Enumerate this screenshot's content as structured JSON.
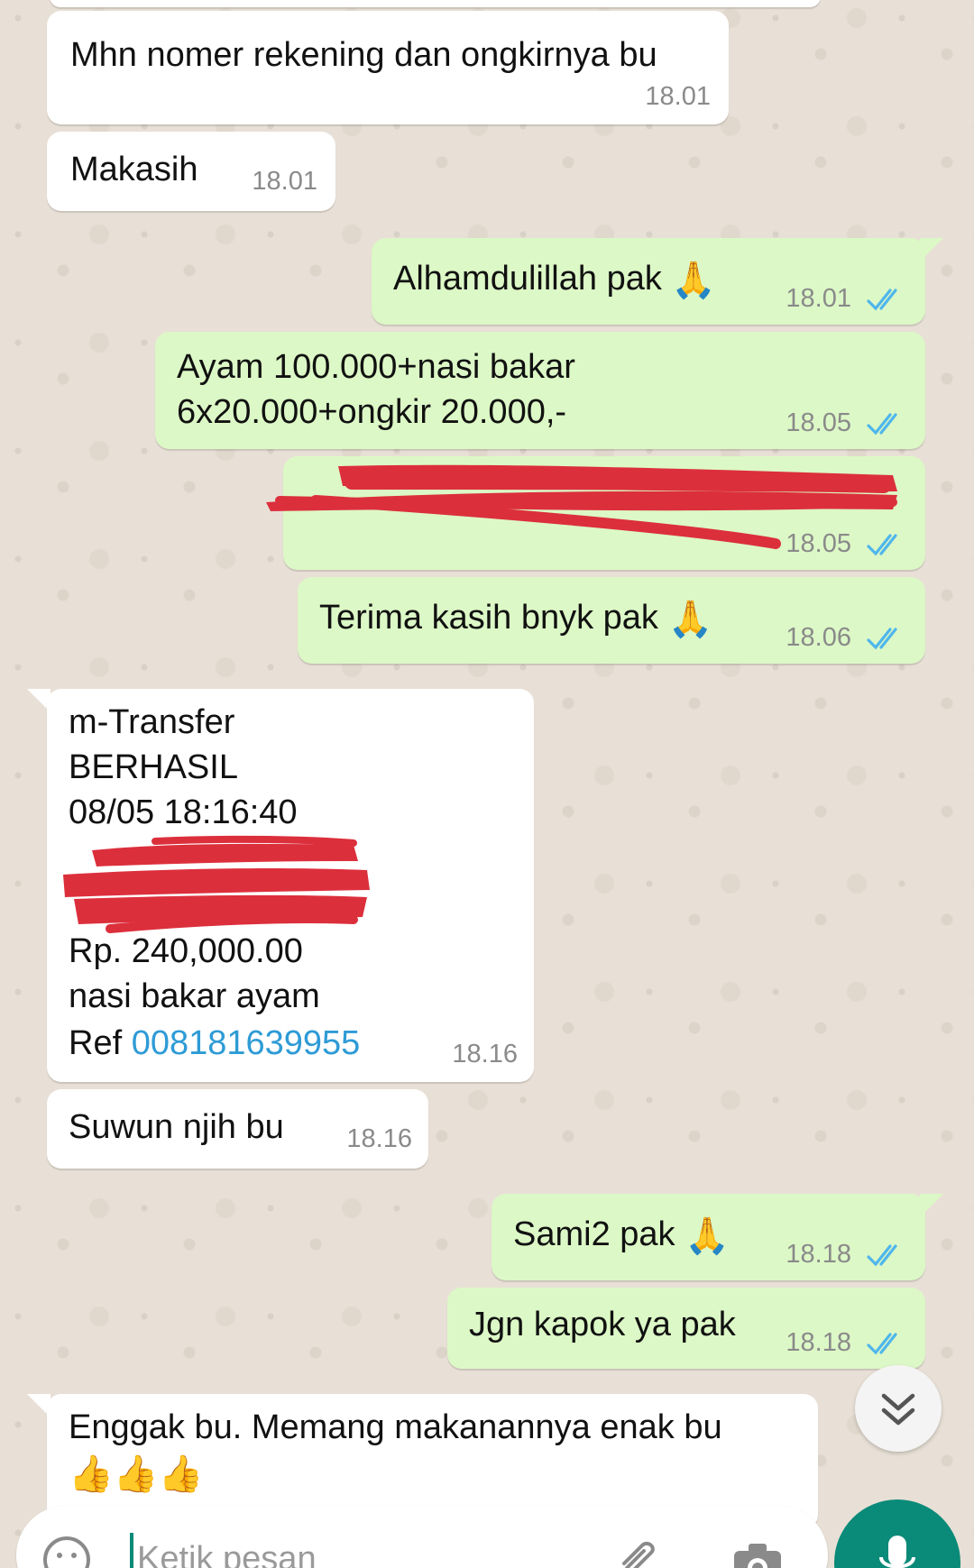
{
  "messages": [
    {
      "dir": "in",
      "text": "Mhn nomer rekening dan ongkirnya bu",
      "time": "18.01"
    },
    {
      "dir": "in",
      "text": "Makasih",
      "time": "18.01"
    },
    {
      "dir": "out",
      "text": "Alhamdulillah pak",
      "emoji": "🙏",
      "time": "18.01",
      "status": "read"
    },
    {
      "dir": "out",
      "lines": [
        "Ayam 100.000+nasi bakar",
        "6x20.000+ongkir 20.000,-"
      ],
      "time": "18.05",
      "status": "read"
    },
    {
      "dir": "out",
      "redacted": true,
      "time": "18.05",
      "status": "read"
    },
    {
      "dir": "out",
      "text": "Terima kasih bnyk pak",
      "emoji": "🙏",
      "time": "18.06",
      "status": "read"
    },
    {
      "dir": "in",
      "lines": [
        "m-Transfer",
        "BERHASIL",
        "08/05 18:16:40",
        "Rp. 240,000.00",
        "nasi bakar ayam"
      ],
      "ref_label": "Ref",
      "ref_number": "008181639955",
      "time": "18.16"
    },
    {
      "dir": "in",
      "text": "Suwun njih bu",
      "time": "18.16"
    },
    {
      "dir": "out",
      "text": "Sami2 pak",
      "emoji": "🙏",
      "time": "18.18",
      "status": "read"
    },
    {
      "dir": "out",
      "text": "Jgn kapok ya pak",
      "time": "18.18",
      "status": "read"
    },
    {
      "dir": "in",
      "text": "Enggak bu. Memang makanannya enak bu",
      "emoji": "👍👍👍"
    }
  ],
  "composer": {
    "placeholder": "Ketik pesan"
  },
  "icons": {
    "read_ticks": "double-check-icon",
    "scroll_down": "chevron-double-down-icon",
    "emoji": "emoji-icon",
    "attach": "paperclip-icon",
    "camera": "camera-icon",
    "mic": "microphone-icon"
  },
  "colors": {
    "incoming": "#ffffff",
    "outgoing": "#dcf8c6",
    "read_ticks": "#4fb6ec",
    "link": "#2e9bd6",
    "mic_button": "#0a8a78"
  }
}
